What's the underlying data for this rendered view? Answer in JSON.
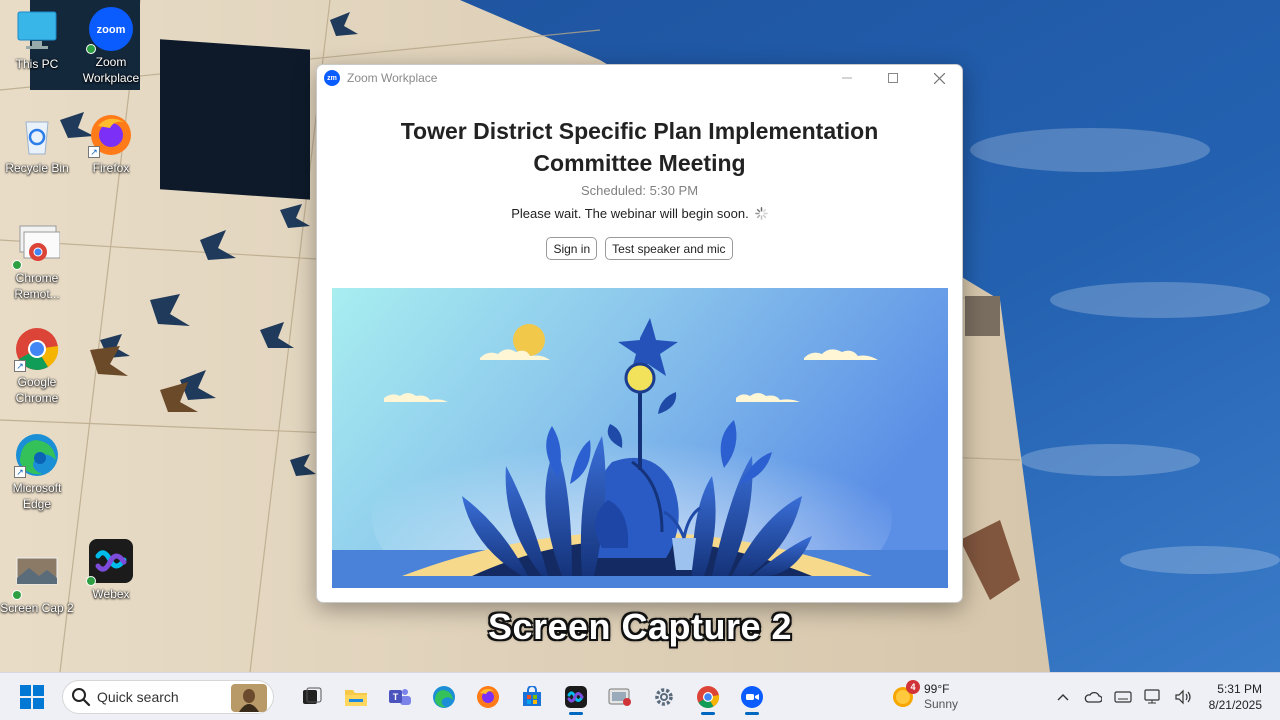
{
  "desktop": {
    "icons": [
      {
        "label": "This PC"
      },
      {
        "label": "Zoom Workplace"
      },
      {
        "label": "Recycle Bin"
      },
      {
        "label": "Firefox"
      },
      {
        "label": "Chrome Remot..."
      },
      {
        "label": "Google Chrome"
      },
      {
        "label": "Microsoft Edge"
      },
      {
        "label": "Screen Cap 2"
      },
      {
        "label": "Webex"
      }
    ]
  },
  "zoom_window": {
    "app_title": "Zoom Workplace",
    "logo_text": "zm",
    "meeting_title_line1": "Tower District Specific Plan Implementation",
    "meeting_title_line2": "Committee Meeting",
    "scheduled": "Scheduled: 5:30 PM",
    "wait_message": "Please wait. The webinar will begin soon.",
    "sign_in_label": "Sign in",
    "test_label": "Test speaker and mic"
  },
  "caption": "Screen Capture 2",
  "taskbar": {
    "search_placeholder": "Quick search",
    "apps": [
      "task-view",
      "file-explorer",
      "teams",
      "edge",
      "firefox",
      "store",
      "webex",
      "snipping",
      "settings",
      "chrome",
      "zoom"
    ],
    "weather": {
      "temp": "99°F",
      "condition": "Sunny",
      "badge": "4"
    },
    "time": "5:31 PM",
    "date": "8/21/2025"
  },
  "colors": {
    "zoom_blue": "#0b5cff",
    "accent": "#0067c0"
  }
}
